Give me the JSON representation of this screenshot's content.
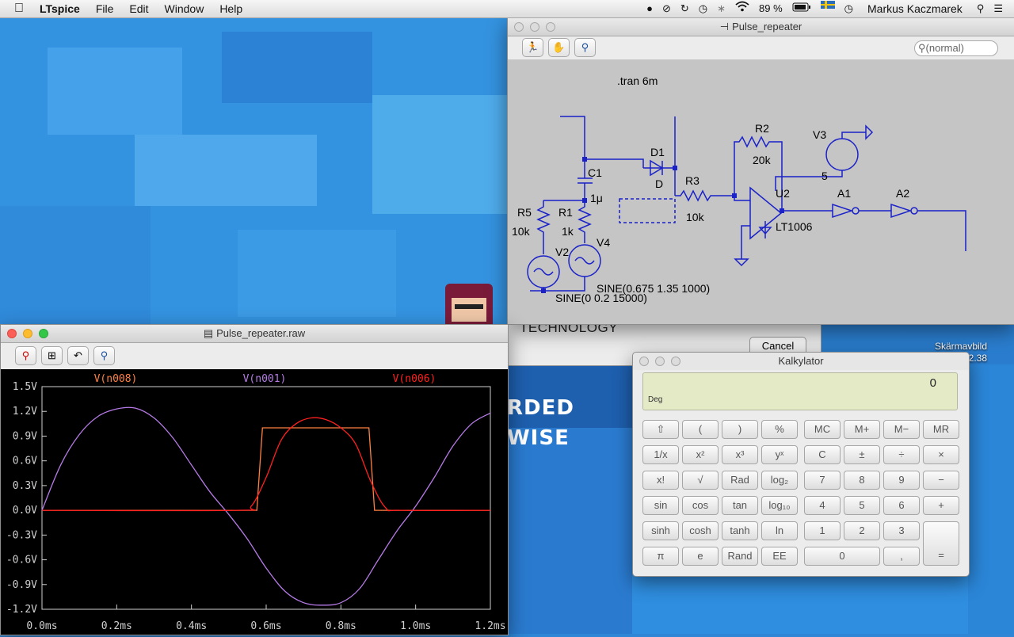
{
  "menubar": {
    "apple": "",
    "app_name": "LTspice",
    "menus": [
      "File",
      "Edit",
      "Window",
      "Help"
    ],
    "battery": "89 %",
    "user": "Markus Kaczmarek"
  },
  "schematic_window": {
    "title": "Pulse_repeater",
    "search_placeholder": "(normal)",
    "directive": ".tran 6m",
    "labels": {
      "r2": "R2",
      "r2v": "20k",
      "v3": "V3",
      "five": "5",
      "d1": "D1",
      "dv": "D",
      "c1": "C1",
      "c1v": "1μ",
      "r3": "R3",
      "r3v": "10k",
      "u2": "U2",
      "u2v": "LT1006",
      "a1": "A1",
      "a2": "A2",
      "r5": "R5",
      "r5v": "10k",
      "r1": "R1",
      "r1v": "1k",
      "v2": "V2",
      "v4": "V4",
      "sine1": "SINE(0.675 1.35 1000)",
      "sine2": "SINE(0 0.2 15000)"
    }
  },
  "behind": {
    "label": "TECHNOLOGY",
    "cancel": "Cancel",
    "banner": "RDED WISE",
    "screenshot_line1": "Skärmavbild",
    "screenshot_line2": ".42.38"
  },
  "wave_window": {
    "title": "Pulse_repeater.raw"
  },
  "chart_data": {
    "type": "line",
    "title": "",
    "xlabel": "",
    "ylabel": "",
    "xlim": [
      0,
      1.2
    ],
    "ylim": [
      -1.2,
      1.5
    ],
    "x_ticks": [
      "0.0ms",
      "0.2ms",
      "0.4ms",
      "0.6ms",
      "0.8ms",
      "1.0ms",
      "1.2ms"
    ],
    "y_ticks": [
      "1.5V",
      "1.2V",
      "0.9V",
      "0.6V",
      "0.3V",
      "0.0V",
      "-0.3V",
      "-0.6V",
      "-0.9V",
      "-1.2V"
    ],
    "series": [
      {
        "name": "V(n008)",
        "color": "#ff8040",
        "x": [
          0,
          0.575,
          0.59,
          0.875,
          0.89,
          1.2
        ],
        "y": [
          0,
          0,
          1.0,
          1.0,
          0,
          0
        ]
      },
      {
        "name": "V(n001)",
        "color": "#b67ae6",
        "x": [
          0,
          0.05,
          0.1,
          0.15,
          0.2,
          0.25,
          0.3,
          0.35,
          0.4,
          0.45,
          0.5,
          0.55,
          0.6,
          0.65,
          0.7,
          0.75,
          0.8,
          0.85,
          0.9,
          0.95,
          1.0,
          1.05,
          1.1,
          1.15,
          1.2
        ],
        "y": [
          0.0,
          0.55,
          0.92,
          1.14,
          1.23,
          1.24,
          1.12,
          0.88,
          0.55,
          0.22,
          -0.05,
          -0.35,
          -0.7,
          -0.98,
          -1.12,
          -1.15,
          -1.12,
          -0.95,
          -0.6,
          -0.25,
          0.05,
          0.4,
          0.78,
          1.05,
          1.18
        ]
      },
      {
        "name": "V(n006)",
        "color": "#ff2020",
        "x": [
          0,
          0.52,
          0.56,
          0.6,
          0.64,
          0.68,
          0.72,
          0.76,
          0.8,
          0.84,
          0.88,
          0.92,
          0.96,
          1.2
        ],
        "y": [
          0,
          0,
          0.05,
          0.4,
          0.85,
          1.05,
          1.12,
          1.1,
          1.0,
          0.8,
          0.35,
          0.03,
          0,
          0
        ]
      }
    ]
  },
  "calculator": {
    "title": "Kalkylator",
    "value": "0",
    "mode": "Deg",
    "rows": [
      [
        "⇧",
        "(",
        ")",
        "%",
        "MC",
        "M+",
        "M−",
        "MR"
      ],
      [
        "1/x",
        "x²",
        "x³",
        "yˣ",
        "C",
        "±",
        "÷",
        "×"
      ],
      [
        "x!",
        "√",
        "Rad",
        "log₂",
        "7",
        "8",
        "9",
        "−"
      ],
      [
        "sin",
        "cos",
        "tan",
        "log₁₀",
        "4",
        "5",
        "6",
        "+"
      ],
      [
        "sinh",
        "cosh",
        "tanh",
        "ln",
        "1",
        "2",
        "3"
      ],
      [
        "π",
        "e",
        "Rand",
        "EE",
        "0",
        ","
      ]
    ],
    "equals": "="
  }
}
